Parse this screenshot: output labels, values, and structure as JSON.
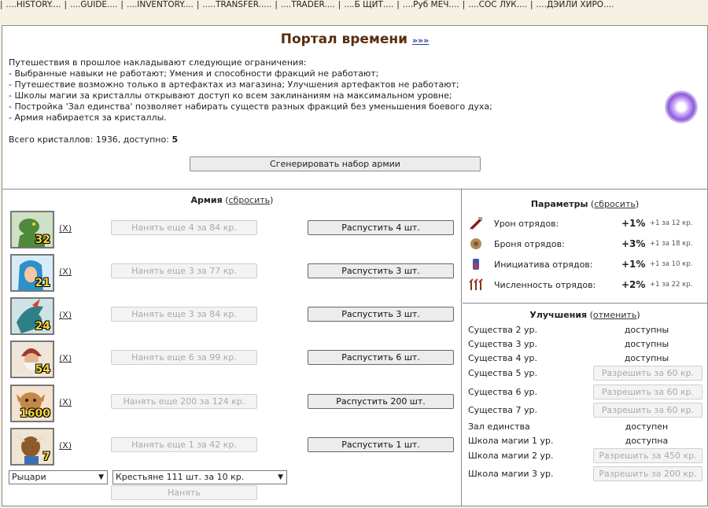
{
  "topnav": [
    "....HISTORY....",
    "....GUIDE....",
    "....INVENTORY....",
    ".....TRANSFER.....",
    "....TRADER....",
    "....Б ЩИТ....",
    "....Руб МЕЧ....",
    "....СОС ЛУК....",
    "....ДЭЙЛИ ХИРО...."
  ],
  "header": {
    "title": "Портал времени",
    "title_link": "»»»",
    "intro": "Путешествия в прошлое накладывают следующие ограничения:",
    "rules": [
      "- Выбранные навыки не работают; Умения и способности фракций не работают;",
      "- Путешествие возможно только в артефактах из магазина; Улучшения артефактов не работают;",
      "- Школы магии за кристаллы открывают доступ ко всем заклинаниям на максимальном уровне;",
      "- Постройка 'Зал единства' позволяет набирать существ разных фракций без уменьшения боевого духа;",
      "- Армия набирается за кристаллы."
    ],
    "crystals_label": "Всего кристаллов: 1936, доступно:",
    "crystals_available": "5",
    "generate_button": "Сгенерировать набор армии"
  },
  "army": {
    "title": "Армия",
    "reset": "сбросить",
    "remove_label": "(X)",
    "units": [
      {
        "count": "32",
        "hire": "Нанять еще 4 за 84 кр.",
        "dismiss": "Распустить 4 шт.",
        "icon": "lizard-warrior-icon",
        "bg": "#cfe1c4",
        "fg": "#4e8a3a"
      },
      {
        "count": "21",
        "hire": "Нанять еще 3 за 77 кр.",
        "dismiss": "Распустить 3 шт.",
        "icon": "elf-icon",
        "bg": "#d8ecf7",
        "fg": "#2e8fc9"
      },
      {
        "count": "24",
        "hire": "Нанять еще 3 за 84 кр.",
        "dismiss": "Распустить 3 шт.",
        "icon": "dragon-icon",
        "bg": "#cfe2e6",
        "fg": "#2f7f86"
      },
      {
        "count": "54",
        "hire": "Нанять еще 6 за 99 кр.",
        "dismiss": "Распустить 6 шт.",
        "icon": "bearded-mage-icon",
        "bg": "#efe6d9",
        "fg": "#9b3b2e"
      },
      {
        "count": "1600",
        "hire": "Нанять еще 200 за 124 кр.",
        "dismiss": "Распустить 200 шт.",
        "icon": "goblin-icon",
        "bg": "#f3e3cf",
        "fg": "#c6874a"
      },
      {
        "count": "7",
        "hire": "Нанять еще 1 за 42 кр.",
        "dismiss": "Распустить 1 шт.",
        "icon": "minotaur-icon",
        "bg": "#f0e5d2",
        "fg": "#8d5a2b"
      }
    ],
    "faction_select": "Рыцари",
    "unit_select": "Крестьяне 111 шт. за 10 кр.",
    "hire_button": "Нанять"
  },
  "params": {
    "title": "Параметры",
    "reset": "сбросить",
    "items": [
      {
        "name": "Урон отрядов:",
        "value": "+1%",
        "note": "+1 за 12 кр.",
        "icon": "damage-icon"
      },
      {
        "name": "Броня отрядов:",
        "value": "+3%",
        "note": "+1 за 18 кр.",
        "icon": "armor-icon"
      },
      {
        "name": "Инициатива отрядов:",
        "value": "+1%",
        "note": "+1 за 10 кр.",
        "icon": "initiative-icon"
      },
      {
        "name": "Численность отрядов:",
        "value": "+2%",
        "note": "+1 за 22 кр.",
        "icon": "troop-count-icon"
      }
    ]
  },
  "upgrades": {
    "title": "Улучшения",
    "cancel": "отменить",
    "items": [
      {
        "label": "Существа 2 ур.",
        "status": "доступны"
      },
      {
        "label": "Существа 3 ур.",
        "status": "доступны"
      },
      {
        "label": "Существа 4 ур.",
        "status": "доступны"
      },
      {
        "label": "Существа 5 ур.",
        "button": "Разрешить за 60 кр."
      },
      {
        "label": "Существа 6 ур.",
        "button": "Разрешить за 60 кр."
      },
      {
        "label": "Существа 7 ур.",
        "button": "Разрешить за 60 кр."
      },
      {
        "label": "Зал единства",
        "status": "доступен"
      },
      {
        "label": "Школа магии 1 ур.",
        "status": "доступна"
      },
      {
        "label": "Школа магии 2 ур.",
        "button": "Разрешить за 450 кр."
      },
      {
        "label": "Школа магии 3 ур.",
        "button": "Разрешить за 200 кр."
      }
    ]
  }
}
